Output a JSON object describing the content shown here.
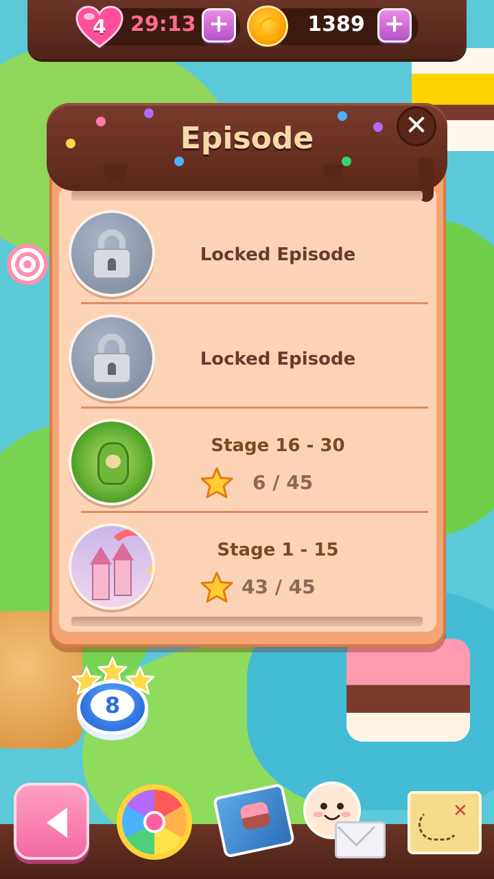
{
  "status_bar": {
    "lives": "4",
    "life_timer": "29:13",
    "coins": "1389",
    "add_lives_icon": "plus-icon",
    "add_coins_icon": "plus-icon"
  },
  "panel": {
    "title": "Episode",
    "close_icon": "close-icon",
    "episodes": [
      {
        "label": "Locked Episode",
        "state": "locked"
      },
      {
        "label": "Locked Episode",
        "state": "locked"
      },
      {
        "label": "Stage 16 - 30",
        "state": "unlocked",
        "stars": "6 / 45"
      },
      {
        "label": "Stage 1 - 15",
        "state": "unlocked",
        "stars": "43 / 45"
      }
    ]
  },
  "map": {
    "current_level": "8",
    "level_stars": 3
  },
  "dock": {
    "back_icon": "back-arrow-icon",
    "items": [
      "lucky-wheel-icon",
      "recipe-book-icon",
      "mail-icon",
      "world-map-icon"
    ]
  },
  "colors": {
    "panel_bg": "#fdd3b5",
    "panel_border": "#f5a474",
    "chocolate": "#5a2619",
    "title_text": "#f6d9a8",
    "label_text": "#6b3a2c",
    "star_yellow": "#ffcc33",
    "heart_pink": "#ff4f9a",
    "timer_pink": "#ff6b8d",
    "plus_purple": "#c76bd6"
  }
}
